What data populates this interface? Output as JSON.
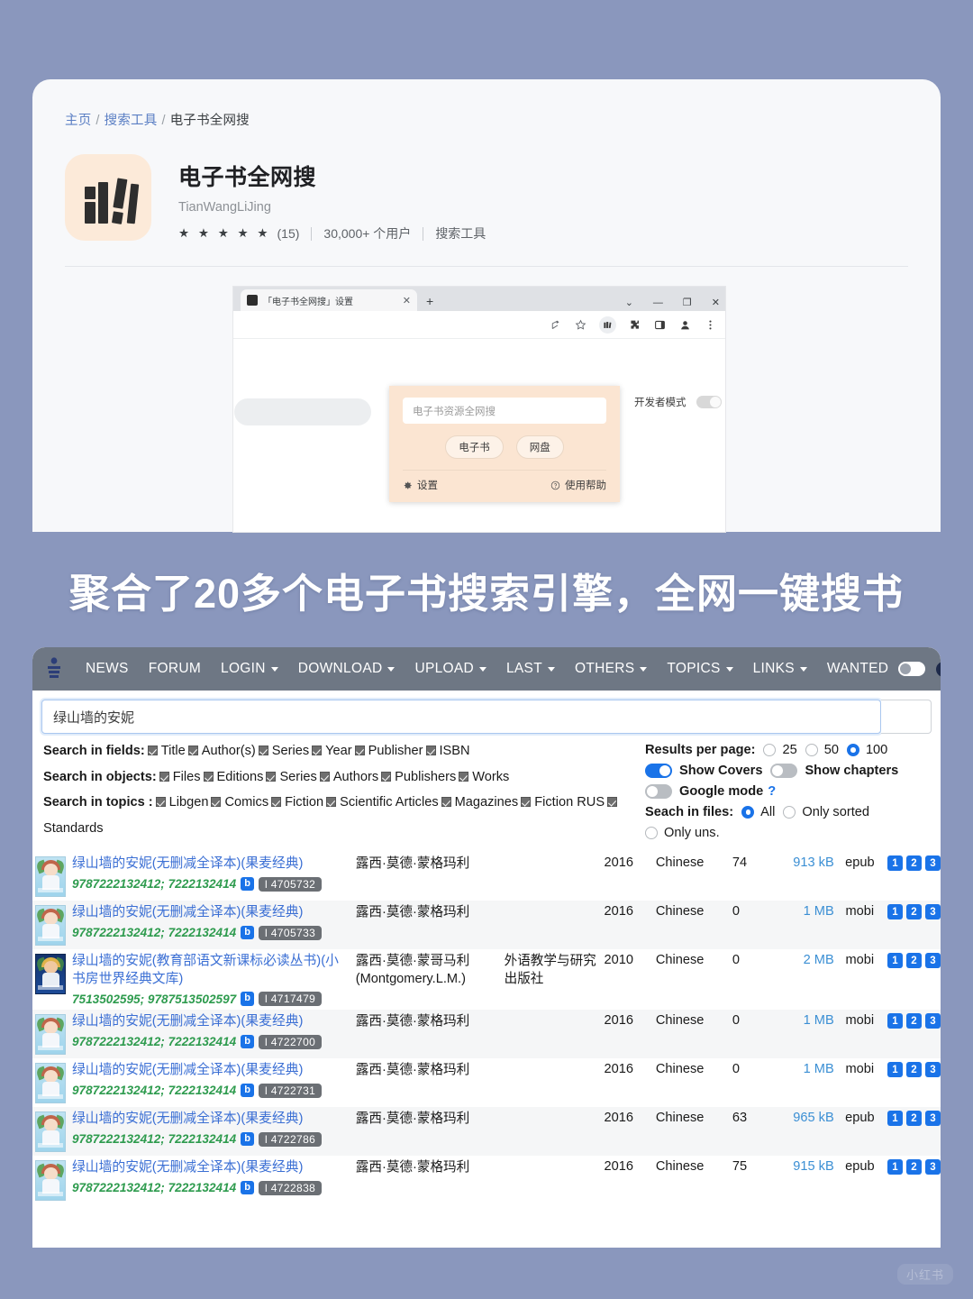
{
  "store": {
    "breadcrumb": {
      "home": "主页",
      "category": "搜索工具",
      "current": "电子书全网搜",
      "separator": "/"
    },
    "extension": {
      "name": "电子书全网搜",
      "author": "TianWangLiJing",
      "stars": "★ ★ ★ ★ ★",
      "rating_count": "(15)",
      "users": "30,000+ 个用户",
      "category": "搜索工具",
      "icon": "books-icon"
    }
  },
  "browser": {
    "tab_title": "「电子书全网搜」设置",
    "tab_close": "✕",
    "new_tab": "+",
    "window_controls": {
      "collapse": "⌄",
      "minimize": "—",
      "maximize": "❐",
      "close": "✕"
    },
    "toolbar_icons": [
      "share-icon",
      "star-icon",
      "extension-active-icon",
      "puzzle-icon",
      "sidepanel-icon",
      "profile-icon",
      "more-icon"
    ],
    "popup": {
      "input_placeholder": "电子书资源全网搜",
      "buttons": [
        "电子书",
        "网盘"
      ],
      "settings_label": "设置",
      "help_label": "使用帮助"
    },
    "dev_mode_label": "开发者模式"
  },
  "headline": "聚合了20多个电子书搜索引擎，全网一键搜书",
  "libgen": {
    "nav": [
      {
        "label": "NEWS",
        "dropdown": false
      },
      {
        "label": "FORUM",
        "dropdown": false
      },
      {
        "label": "LOGIN",
        "dropdown": true
      },
      {
        "label": "DOWNLOAD",
        "dropdown": true
      },
      {
        "label": "UPLOAD",
        "dropdown": true
      },
      {
        "label": "LAST",
        "dropdown": true
      },
      {
        "label": "OTHERS",
        "dropdown": true
      },
      {
        "label": "TOPICS",
        "dropdown": true
      },
      {
        "label": "LINKS",
        "dropdown": true
      },
      {
        "label": "WANTED",
        "dropdown": false
      }
    ],
    "search_query": "绿山墙的安妮",
    "filters": {
      "fields_label": "Search in fields:",
      "fields": [
        "Title",
        "Author(s)",
        "Series",
        "Year",
        "Publisher",
        "ISBN"
      ],
      "objects_label": "Search in objects:",
      "objects": [
        "Files",
        "Editions",
        "Series",
        "Authors",
        "Publishers",
        "Works"
      ],
      "topics_label": "Search in topics :",
      "topics": [
        "Libgen",
        "Comics",
        "Fiction",
        "Scientific Articles",
        "Magazines",
        "Fiction RUS",
        "Standards"
      ]
    },
    "options": {
      "results_per_page_label": "Results per page:",
      "results_per_page": [
        "25",
        "50",
        "100"
      ],
      "results_per_page_selected": "100",
      "show_covers_label": "Show Covers",
      "show_covers_on": true,
      "show_chapters_label": "Show chapters",
      "show_chapters_on": false,
      "google_mode_label": "Google mode",
      "google_mode_help": "?",
      "google_mode_on": false,
      "search_in_files_label": "Seach in files:",
      "search_in_files": [
        "All",
        "Only sorted",
        "Only uns."
      ],
      "search_in_files_selected": "All"
    },
    "results": [
      {
        "cover": "light",
        "title": "绿山墙的安妮(无删减全译本)(果麦经典)",
        "isbn": "9787222132412; 7222132414",
        "badge_b": "b",
        "id": "l 4705732",
        "author": "露西·莫德·蒙格玛利",
        "publisher": "",
        "year": "2016",
        "language": "Chinese",
        "pages": "74",
        "size": "913 kB",
        "extension": "epub",
        "mirrors": [
          "1",
          "2",
          "3"
        ]
      },
      {
        "cover": "light",
        "title": "绿山墙的安妮(无删减全译本)(果麦经典)",
        "isbn": "9787222132412; 7222132414",
        "badge_b": "b",
        "id": "l 4705733",
        "author": "露西·莫德·蒙格玛利",
        "publisher": "",
        "year": "2016",
        "language": "Chinese",
        "pages": "0",
        "size": "1 MB",
        "extension": "mobi",
        "mirrors": [
          "1",
          "2",
          "3"
        ]
      },
      {
        "cover": "dark",
        "title": "绿山墙的安妮(教育部语文新课标必读丛书)(小书房世界经典文库)",
        "isbn": "7513502595; 9787513502597",
        "badge_b": "b",
        "id": "l 4717479",
        "author": "露西·莫德·蒙哥马利 (Montgomery.L.M.)",
        "publisher": "外语教学与研究出版社",
        "year": "2010",
        "language": "Chinese",
        "pages": "0",
        "size": "2 MB",
        "extension": "mobi",
        "mirrors": [
          "1",
          "2",
          "3"
        ]
      },
      {
        "cover": "light",
        "title": "绿山墙的安妮(无删减全译本)(果麦经典)",
        "isbn": "9787222132412; 7222132414",
        "badge_b": "b",
        "id": "l 4722700",
        "author": "露西·莫德·蒙格玛利",
        "publisher": "",
        "year": "2016",
        "language": "Chinese",
        "pages": "0",
        "size": "1 MB",
        "extension": "mobi",
        "mirrors": [
          "1",
          "2",
          "3"
        ]
      },
      {
        "cover": "light",
        "title": "绿山墙的安妮(无删减全译本)(果麦经典)",
        "isbn": "9787222132412; 7222132414",
        "badge_b": "b",
        "id": "l 4722731",
        "author": "露西·莫德·蒙格玛利",
        "publisher": "",
        "year": "2016",
        "language": "Chinese",
        "pages": "0",
        "size": "1 MB",
        "extension": "mobi",
        "mirrors": [
          "1",
          "2",
          "3"
        ]
      },
      {
        "cover": "light",
        "title": "绿山墙的安妮(无删减全译本)(果麦经典)",
        "isbn": "9787222132412; 7222132414",
        "badge_b": "b",
        "id": "l 4722786",
        "author": "露西·莫德·蒙格玛利",
        "publisher": "",
        "year": "2016",
        "language": "Chinese",
        "pages": "63",
        "size": "965 kB",
        "extension": "epub",
        "mirrors": [
          "1",
          "2",
          "3"
        ]
      },
      {
        "cover": "light",
        "title": "绿山墙的安妮(无删减全译本)(果麦经典)",
        "isbn": "9787222132412; 7222132414",
        "badge_b": "b",
        "id": "l 4722838",
        "author": "露西·莫德·蒙格玛利",
        "publisher": "",
        "year": "2016",
        "language": "Chinese",
        "pages": "75",
        "size": "915 kB",
        "extension": "epub",
        "mirrors": [
          "1",
          "2",
          "3"
        ]
      }
    ]
  },
  "watermark": "小红书",
  "colors": {
    "background": "#8a97bd",
    "accent_blue": "#1a73e8",
    "link_blue": "#3b6fd4",
    "isbn_green": "#2e9b4e",
    "nav_grey": "#6e7784",
    "popup_peach": "#fbe5d2",
    "icon_peach": "#fcead9"
  }
}
